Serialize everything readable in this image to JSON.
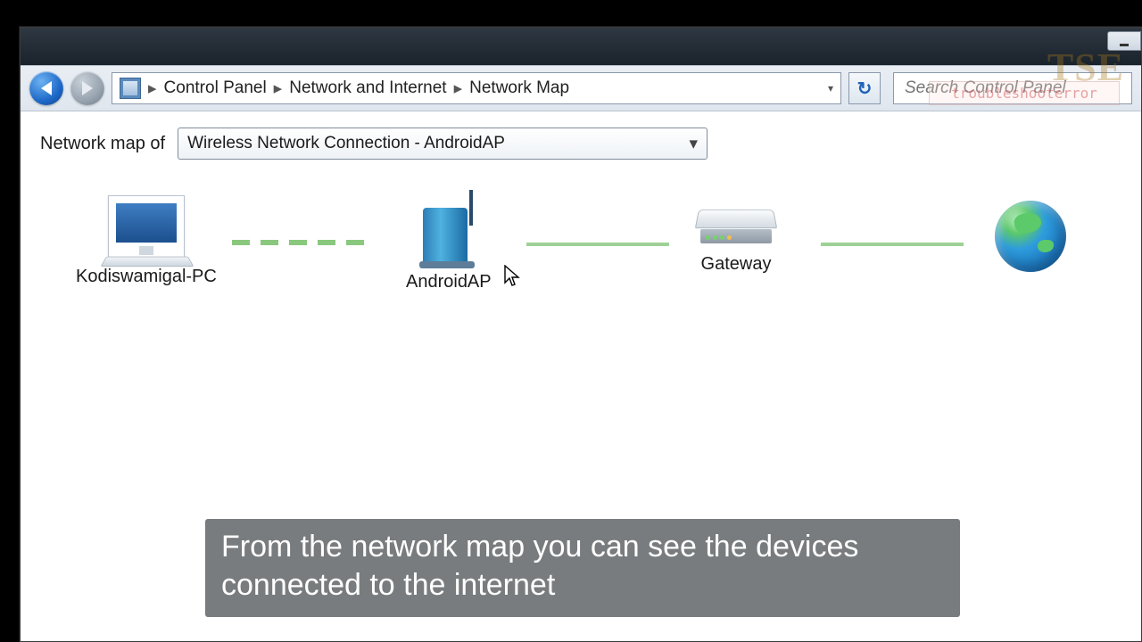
{
  "breadcrumb": {
    "root": "Control Panel",
    "mid": "Network and Internet",
    "leaf": "Network Map"
  },
  "search": {
    "placeholder": "Search Control Panel"
  },
  "watermark": {
    "big": "TSE",
    "small": "troubleshooterror"
  },
  "label_network_map_of": "Network map of",
  "dropdown": {
    "selected": "Wireless Network Connection - AndroidAP"
  },
  "nodes": {
    "pc": "Kodiswamigal-PC",
    "ap": "AndroidAP",
    "gw": "Gateway",
    "internet": ""
  },
  "caption": "From the network map you can see the devices connected to the internet"
}
